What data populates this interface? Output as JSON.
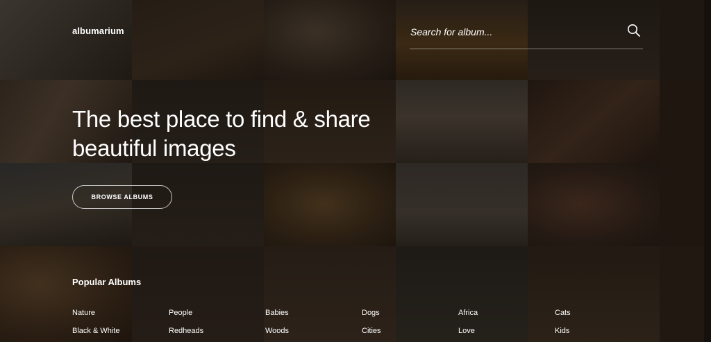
{
  "brand": {
    "logo_text": "albumarium"
  },
  "search": {
    "placeholder": "Search for album...",
    "icon": "search-icon"
  },
  "hero": {
    "title": "The best place to find & share beautiful images",
    "browse_button_label": "BROWSE ALBUMS"
  },
  "popular": {
    "heading": "Popular Albums",
    "albums": [
      "Nature",
      "People",
      "Babies",
      "Dogs",
      "Africa",
      "Cats",
      "Black & White",
      "Redheads",
      "Woods",
      "Cities",
      "Love",
      "Kids"
    ]
  },
  "colors": {
    "overlay": "#140e0a",
    "text": "#ffffff"
  }
}
